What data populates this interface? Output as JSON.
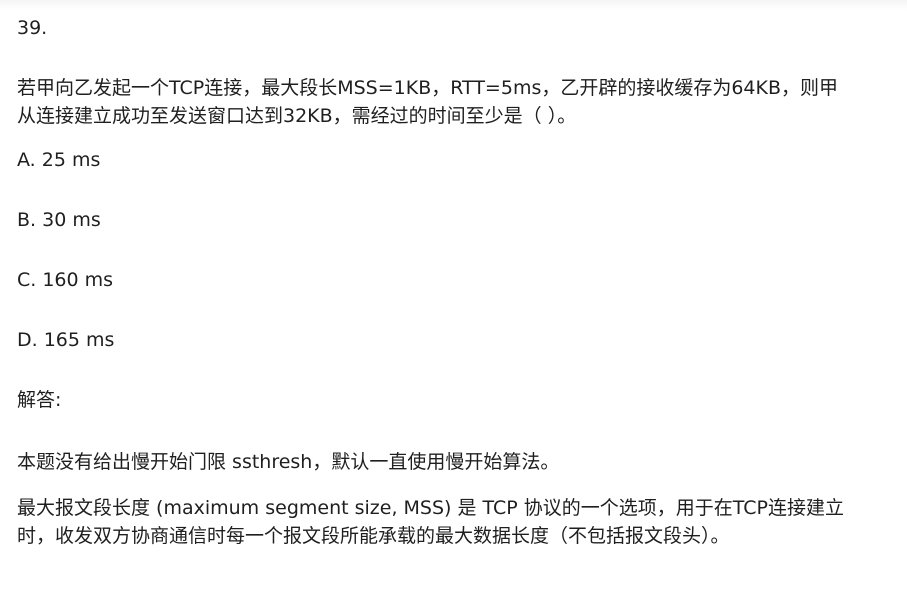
{
  "question": {
    "number": "39.",
    "stem_line1": "若甲向乙发起一个TCP连接，最大段长MSS=1KB，RTT=5ms，乙开辟的接收缓存为64KB，则甲",
    "stem_line2": "从连接建立成功至发送窗口达到32KB，需经过的时间至少是（ ）。",
    "options": [
      "A. 25 ms",
      "B. 30 ms",
      "C. 160 ms",
      "D. 165 ms"
    ]
  },
  "answer": {
    "label": "解答:",
    "paragraph1": "本题没有给出慢开始门限 ssthresh，默认一直使用慢开始算法。",
    "paragraph2_line1": "最大报文段长度 (maximum segment size, MSS) 是 TCP 协议的一个选项，用于在TCP连接建立",
    "paragraph2_line2": "时，收发双方协商通信时每一个报文段所能承载的最大数据长度（不包括报文段头）。"
  }
}
